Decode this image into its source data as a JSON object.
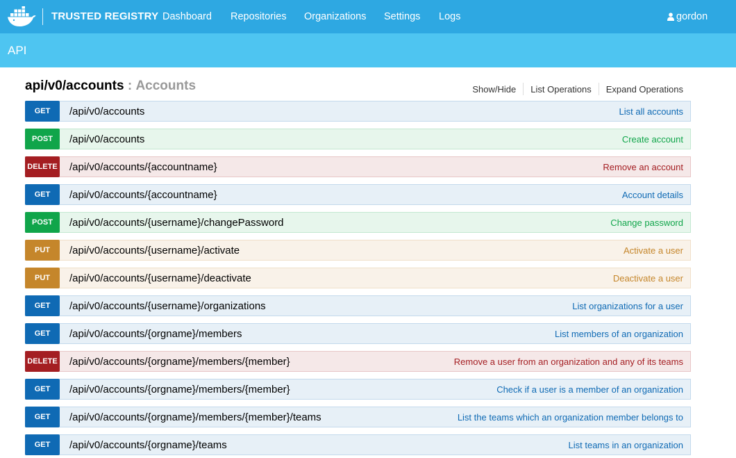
{
  "navbar": {
    "brand": "TRUSTED REGISTRY",
    "links": [
      "Dashboard",
      "Repositories",
      "Organizations",
      "Settings",
      "Logs"
    ],
    "user": "gordon",
    "logo_icon": "docker-whale-icon",
    "user_icon": "user-icon",
    "color": "#2ea8e2"
  },
  "api_bar": {
    "title": "API",
    "color": "#4ec5f1"
  },
  "resource": {
    "path": "api/v0/accounts",
    "separator": ":",
    "name": "Accounts",
    "actions": [
      "Show/Hide",
      "List Operations",
      "Expand Operations"
    ]
  },
  "operations": [
    {
      "method": "GET",
      "path": "/api/v0/accounts",
      "summary": "List all accounts"
    },
    {
      "method": "POST",
      "path": "/api/v0/accounts",
      "summary": "Create account"
    },
    {
      "method": "DELETE",
      "path": "/api/v0/accounts/{accountname}",
      "summary": "Remove an account"
    },
    {
      "method": "GET",
      "path": "/api/v0/accounts/{accountname}",
      "summary": "Account details"
    },
    {
      "method": "POST",
      "path": "/api/v0/accounts/{username}/changePassword",
      "summary": "Change password"
    },
    {
      "method": "PUT",
      "path": "/api/v0/accounts/{username}/activate",
      "summary": "Activate a user"
    },
    {
      "method": "PUT",
      "path": "/api/v0/accounts/{username}/deactivate",
      "summary": "Deactivate a user"
    },
    {
      "method": "GET",
      "path": "/api/v0/accounts/{username}/organizations",
      "summary": "List organizations for a user"
    },
    {
      "method": "GET",
      "path": "/api/v0/accounts/{orgname}/members",
      "summary": "List members of an organization"
    },
    {
      "method": "DELETE",
      "path": "/api/v0/accounts/{orgname}/members/{member}",
      "summary": "Remove a user from an organization and any of its teams"
    },
    {
      "method": "GET",
      "path": "/api/v0/accounts/{orgname}/members/{member}",
      "summary": "Check if a user is a member of an organization"
    },
    {
      "method": "GET",
      "path": "/api/v0/accounts/{orgname}/members/{member}/teams",
      "summary": "List the teams which an organization member belongs to"
    },
    {
      "method": "GET",
      "path": "/api/v0/accounts/{orgname}/teams",
      "summary": "List teams in an organization"
    }
  ],
  "method_colors": {
    "GET": "#0f6ab4",
    "POST": "#10a54a",
    "DELETE": "#a41e22",
    "PUT": "#c5862b"
  }
}
